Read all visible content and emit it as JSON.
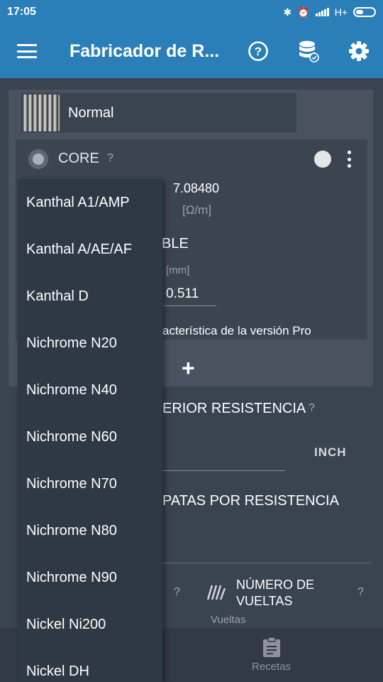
{
  "status_bar": {
    "time": "17:05",
    "network": "H+"
  },
  "app_bar": {
    "title": "Fabricador de R..."
  },
  "coil": {
    "name": "Normal"
  },
  "wire": {
    "mode_label": "CORE",
    "help": "?",
    "resistivity_value": "7.08480",
    "resistivity_unit": "[Ω/m]",
    "section_label_partial": "BLE",
    "diameter_unit": "[mm]",
    "diameter_value": "0.511",
    "pro_note_partial": "acterística de la versión Pro"
  },
  "add_button": {
    "label": "+"
  },
  "inner_diameter": {
    "label_partial": "ERIOR RESISTENCIA",
    "help": "?",
    "unit_button": "INCH"
  },
  "legs": {
    "label_partial": "PATAS POR RESISTENCIA"
  },
  "turns": {
    "left_help": "?",
    "label_line1": "NÚMERO DE",
    "label_line2": "VUELTAS",
    "help": "?",
    "sublabel": "Vueltas"
  },
  "bottom_nav": {
    "recipes_label": "Recetas"
  },
  "dropdown": {
    "options": [
      "Kanthal A1/AMP",
      "Kanthal A/AE/AF",
      "Kanthal D",
      "Nichrome N20",
      "Nichrome N40",
      "Nichrome N60",
      "Nichrome N70",
      "Nichrome N80",
      "Nichrome N90",
      "Nickel Ni200",
      "Nickel DH"
    ]
  },
  "colors": {
    "app_bar": "#2b7fb8",
    "background": "#3a4350",
    "card": "#4a5260",
    "dropdown": "#2f3845"
  }
}
